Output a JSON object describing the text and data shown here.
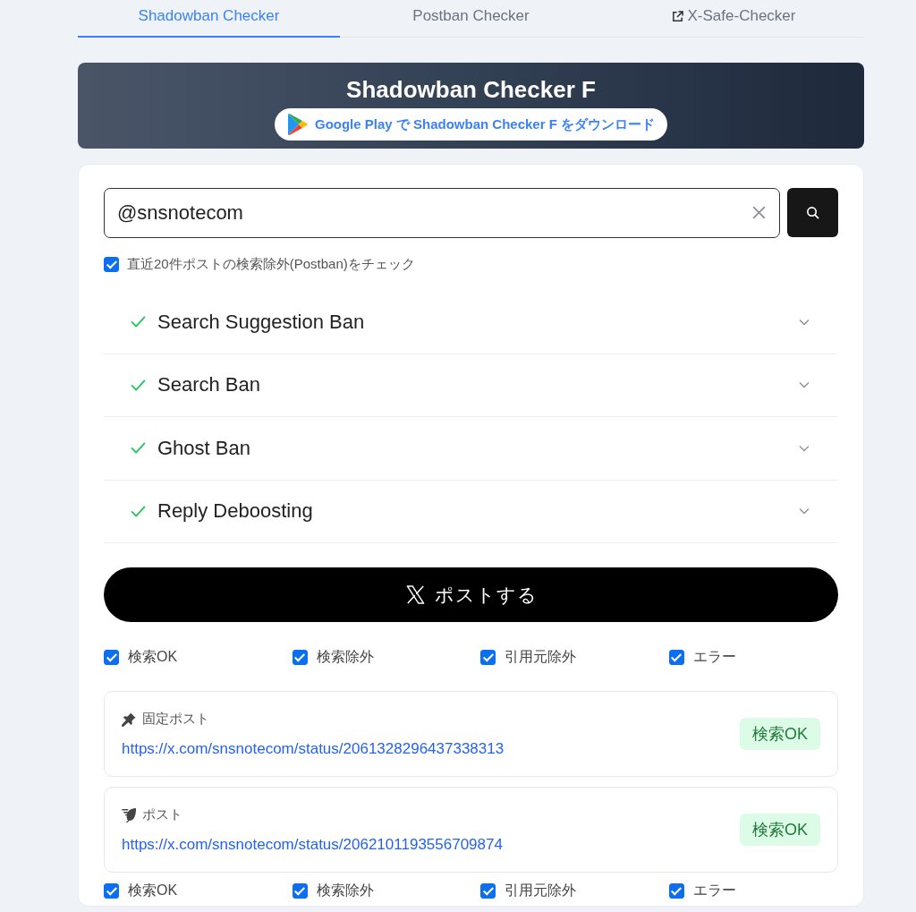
{
  "tabs": [
    {
      "label": "Shadowban Checker",
      "selected": true,
      "external": false
    },
    {
      "label": "Postban Checker",
      "selected": false,
      "external": false
    },
    {
      "label": "X-Safe-Checker",
      "selected": false,
      "external": true
    }
  ],
  "banner": {
    "title": "Shadowban Checker F",
    "store_button": "Google Play で Shadowban Checker F をダウンロード"
  },
  "search": {
    "value": "@snsnotecom"
  },
  "postban_option": {
    "label": "直近20件ポストの検索除外(Postban)をチェック",
    "checked": true
  },
  "checks": [
    {
      "label": "Search Suggestion Ban",
      "passed": true
    },
    {
      "label": "Search Ban",
      "passed": true
    },
    {
      "label": "Ghost Ban",
      "passed": true
    },
    {
      "label": "Reply Deboosting",
      "passed": true
    }
  ],
  "post_button": {
    "label": "ポストする"
  },
  "filters_top": [
    {
      "label": "検索OK",
      "checked": true
    },
    {
      "label": "検索除外",
      "checked": true
    },
    {
      "label": "引用元除外",
      "checked": true
    },
    {
      "label": "エラー",
      "checked": true
    }
  ],
  "posts": [
    {
      "kind": "pinned",
      "label": "固定ポスト",
      "url": "https://x.com/snsnotecom/status/2061328296437338313",
      "result": {
        "kind": "ok",
        "label": "検索OK"
      }
    },
    {
      "kind": "post",
      "label": "ポスト",
      "url": "https://x.com/snsnotecom/status/2062101193556709874",
      "result": {
        "kind": "ok",
        "label": "検索OK"
      }
    }
  ],
  "filters_bottom": [
    {
      "label": "検索OK",
      "checked": true
    },
    {
      "label": "検索除外",
      "checked": true
    },
    {
      "label": "引用元除外",
      "checked": true
    },
    {
      "label": "エラー",
      "checked": true
    }
  ]
}
